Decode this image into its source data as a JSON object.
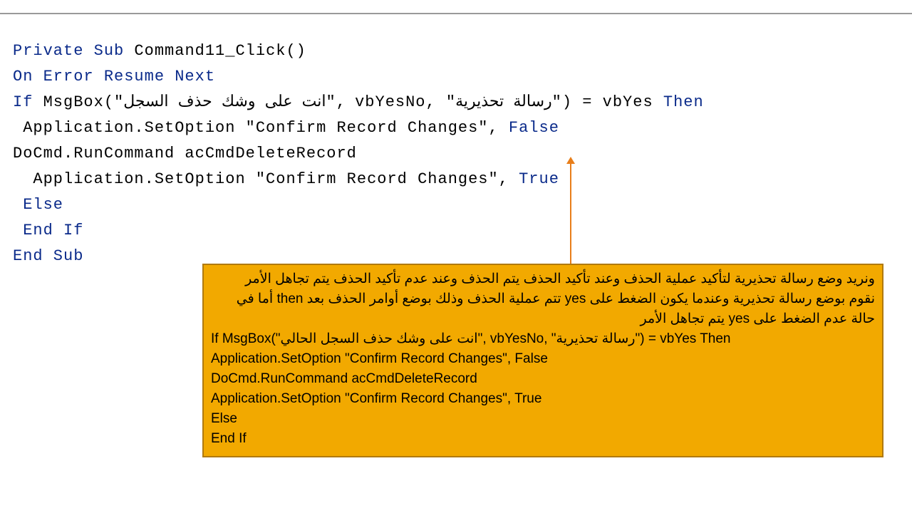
{
  "code": {
    "l1_private": "Private",
    "l1_sub": "Sub",
    "l1_name": " Command11_Click()",
    "l2": "On Error Resume Next",
    "l3_if": "If",
    "l3_msgbox": " MsgBox(",
    "l3_arabic1": "\"انت على وشك حذف السجل\"",
    "l3_mid": ", vbYesNo, ",
    "l3_arabic2": "\"رسالة تحذيرية\"",
    "l3_tail1": ") = vbYes ",
    "l3_then": "Then",
    "l4_a": " Application.SetOption \"Confirm Record Changes\", ",
    "l4_false": "False",
    "l5": "DoCmd.RunCommand acCmdDeleteRecord",
    "l6_a": "  Application.SetOption \"Confirm Record Changes\", ",
    "l6_true": "True",
    "l7": " Else",
    "l8": " End If",
    "l9": "End Sub"
  },
  "callout": {
    "ar1": "ونريد وضع رسالة تحذيرية لتأكيد عملية الحذف وعند تأكيد الحذف يتم الحذف وعند عدم تأكيد الحذف يتم تجاهل الأمر",
    "ar2": "نقوم بوضع رسالة تحذيرية وعندما يكون الضغط على yes تتم عملية الحذف وذلك بوضع أوامر الحذف بعد then أما في حالة عدم الضغط على yes يتم تجاهل الأمر",
    "snip1_a": "If MsgBox(\"",
    "snip1_ar1": "انت على وشك حذف السجل الحالي",
    "snip1_b": "\", vbYesNo, \"",
    "snip1_ar2": "رسالة تحذيرية",
    "snip1_c": "\") = vbYes Then",
    "snip2": " Application.SetOption \"Confirm Record Changes\", False",
    "snip3": "DoCmd.RunCommand acCmdDeleteRecord",
    "snip4": " Application.SetOption \"Confirm Record Changes\", True",
    "snip5": " Else",
    "snip6": " End If"
  }
}
